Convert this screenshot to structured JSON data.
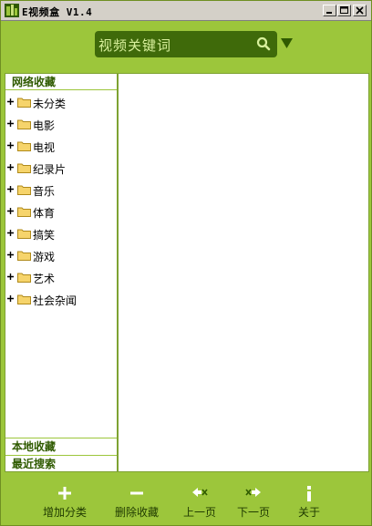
{
  "window": {
    "title": "E视频盒 V1.4"
  },
  "search": {
    "placeholder": "视频关键词"
  },
  "sidebar": {
    "top_tab": "网络收藏",
    "items": [
      {
        "label": "未分类"
      },
      {
        "label": "电影"
      },
      {
        "label": "电视"
      },
      {
        "label": "纪录片"
      },
      {
        "label": "音乐"
      },
      {
        "label": "体育"
      },
      {
        "label": "搞笑"
      },
      {
        "label": "游戏"
      },
      {
        "label": "艺术"
      },
      {
        "label": "社会杂闻"
      }
    ],
    "bottom_tabs": [
      "本地收藏",
      "最近搜索"
    ]
  },
  "toolbar": {
    "add_category": "增加分类",
    "delete_favorite": "删除收藏",
    "prev_page": "上一页",
    "next_page": "下一页",
    "about": "关于"
  },
  "colors": {
    "accent": "#9cc63b",
    "dark_green": "#3f6a0a",
    "header_text": "#2f5a00"
  }
}
